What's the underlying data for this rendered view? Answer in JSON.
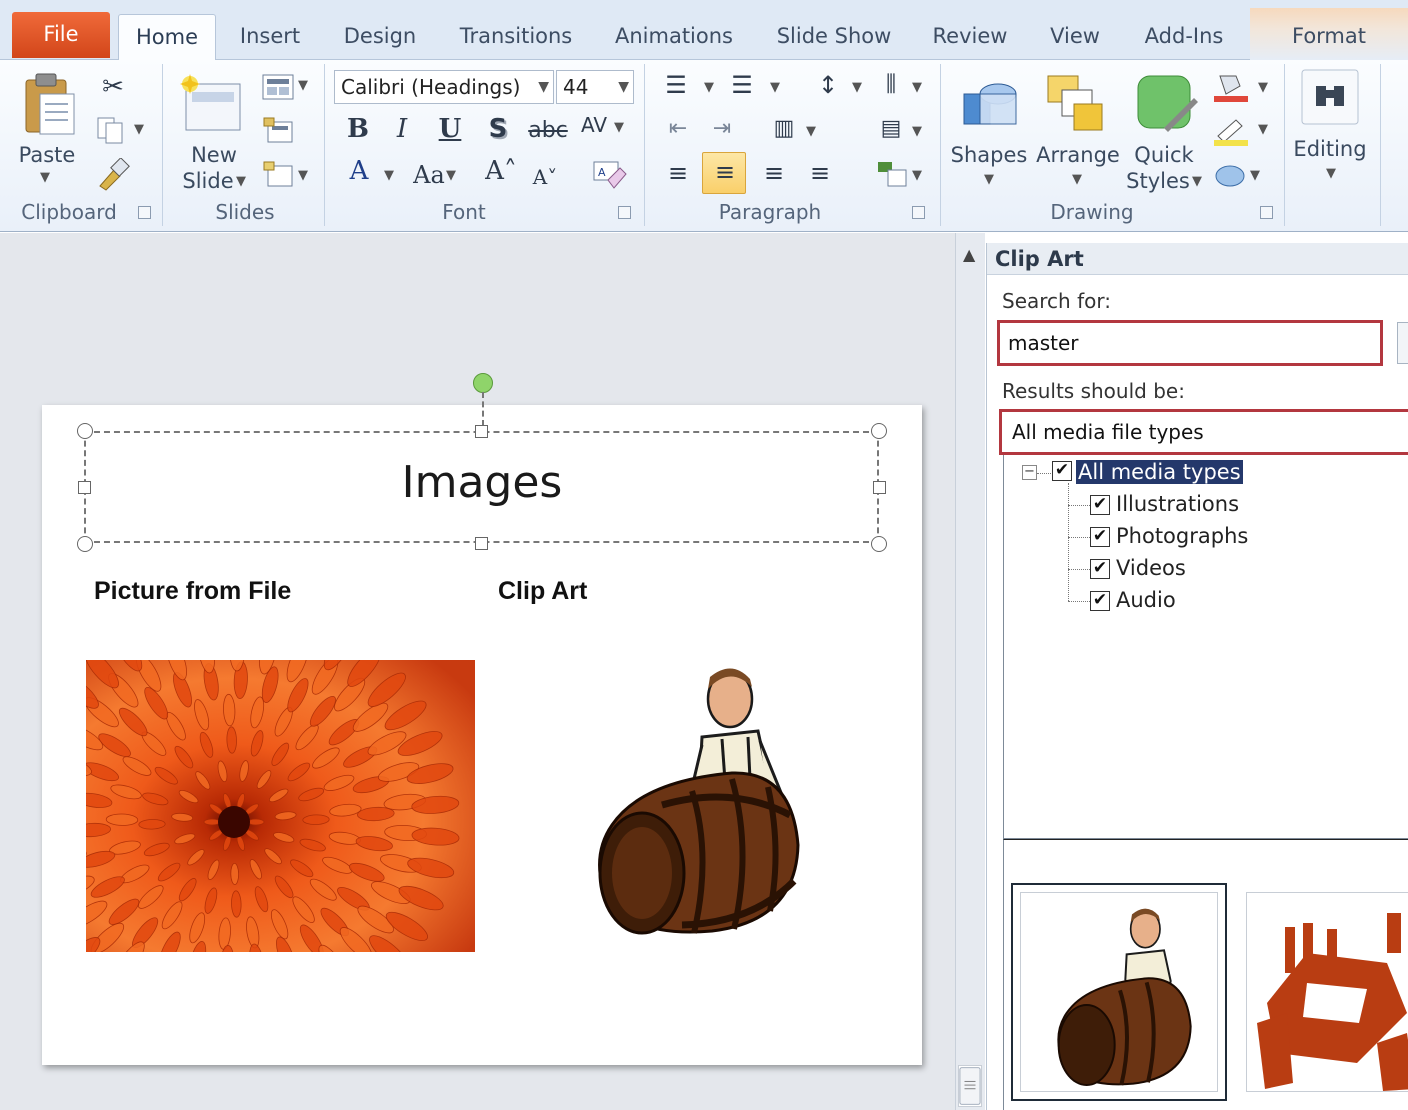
{
  "ribbon": {
    "tabs": [
      "File",
      "Home",
      "Insert",
      "Design",
      "Transitions",
      "Animations",
      "Slide Show",
      "Review",
      "View",
      "Add-Ins",
      "Format"
    ],
    "clipboard": {
      "paste": "Paste",
      "group": "Clipboard"
    },
    "slides": {
      "new_slide_1": "New",
      "new_slide_2": "Slide",
      "group": "Slides"
    },
    "font": {
      "family": "Calibri (Headings)",
      "size": "44",
      "group": "Font"
    },
    "paragraph": {
      "group": "Paragraph"
    },
    "drawing": {
      "shapes": "Shapes",
      "arrange": "Arrange",
      "quick_1": "Quick",
      "quick_2": "Styles",
      "group": "Drawing"
    },
    "editing": {
      "label": "Editing"
    }
  },
  "slide": {
    "title": "Images",
    "left_heading": "Picture from File",
    "right_heading": "Clip Art"
  },
  "pane": {
    "title": "Clip Art",
    "search_label": "Search for:",
    "search_value": "master",
    "results_label": "Results should be:",
    "media_value": "All media file types",
    "tree": {
      "root": "All media types",
      "items": [
        "Illustrations",
        "Photographs",
        "Videos",
        "Audio"
      ]
    }
  },
  "colors": {
    "selection_border": "#b3373f",
    "file_tab": "#d2461a",
    "tree_highlight": "#24386b"
  }
}
